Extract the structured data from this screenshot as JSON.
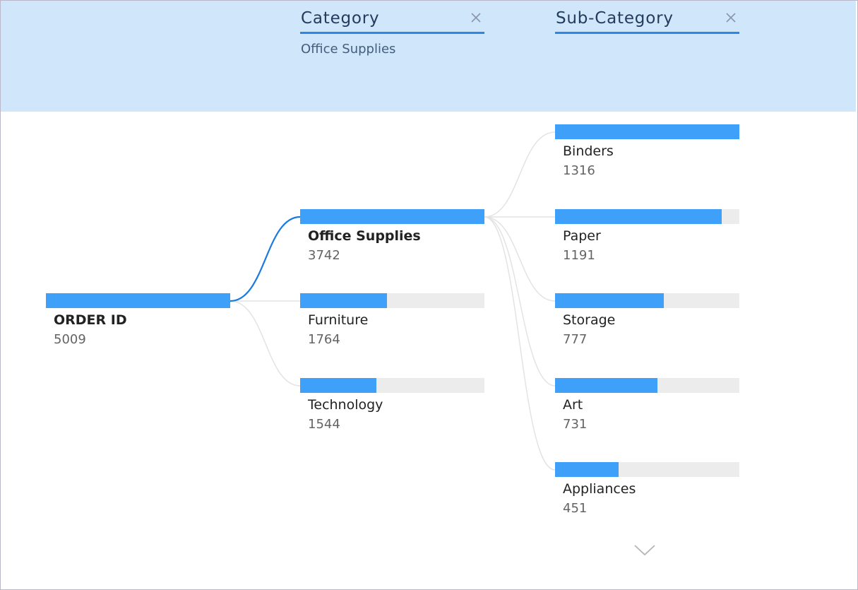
{
  "header": {
    "levels": [
      {
        "title": "Category",
        "filter": "Office Supplies",
        "close_icon": "close-icon"
      },
      {
        "title": "Sub-Category",
        "filter": "",
        "close_icon": "close-icon"
      }
    ]
  },
  "tree": {
    "root": {
      "label": "ORDER ID",
      "value": "5009",
      "fraction": 1.0
    },
    "categories": [
      {
        "label": "Office Supplies",
        "value": "3742",
        "fraction": 1.0,
        "selected": true
      },
      {
        "label": "Furniture",
        "value": "1764",
        "fraction": 0.471
      },
      {
        "label": "Technology",
        "value": "1544",
        "fraction": 0.413
      }
    ],
    "subcategories": [
      {
        "label": "Binders",
        "value": "1316",
        "fraction": 1.0
      },
      {
        "label": "Paper",
        "value": "1191",
        "fraction": 0.905
      },
      {
        "label": "Storage",
        "value": "777",
        "fraction": 0.59
      },
      {
        "label": "Art",
        "value": "731",
        "fraction": 0.555
      },
      {
        "label": "Appliances",
        "value": "451",
        "fraction": 0.343
      }
    ],
    "more_icon": "chevron-down-icon"
  },
  "colors": {
    "header_bg": "#d0e6fb",
    "bar_fill": "#3ea0f8",
    "bar_track": "#ececec",
    "selected_link": "#1a7ae0",
    "link": "#e3e3e3"
  }
}
